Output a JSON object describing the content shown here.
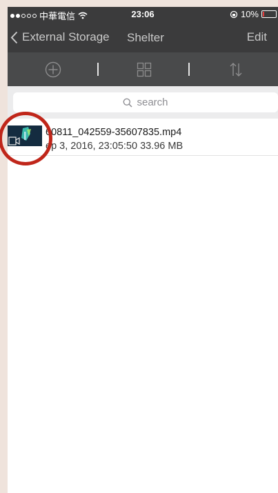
{
  "status_bar": {
    "carrier": "中華電信",
    "time": "23:06",
    "battery": "10%",
    "battery_level": 0.1,
    "battery_color": "#e23a3a"
  },
  "nav": {
    "back_label": "External Storage",
    "title": "Shelter",
    "edit_label": "Edit"
  },
  "toolbar": {
    "items": [
      "add-icon",
      "grid-view-icon",
      "sort-icon"
    ]
  },
  "search": {
    "placeholder": "search"
  },
  "files": [
    {
      "name": "60811_042559-35607835.mp4",
      "meta": "ep 3, 2016, 23:05:50  33.96 MB"
    }
  ],
  "colors": {
    "bar": "#3b3b3c",
    "toolbar": "#494a4b",
    "highlight_ring": "#c0261a"
  }
}
